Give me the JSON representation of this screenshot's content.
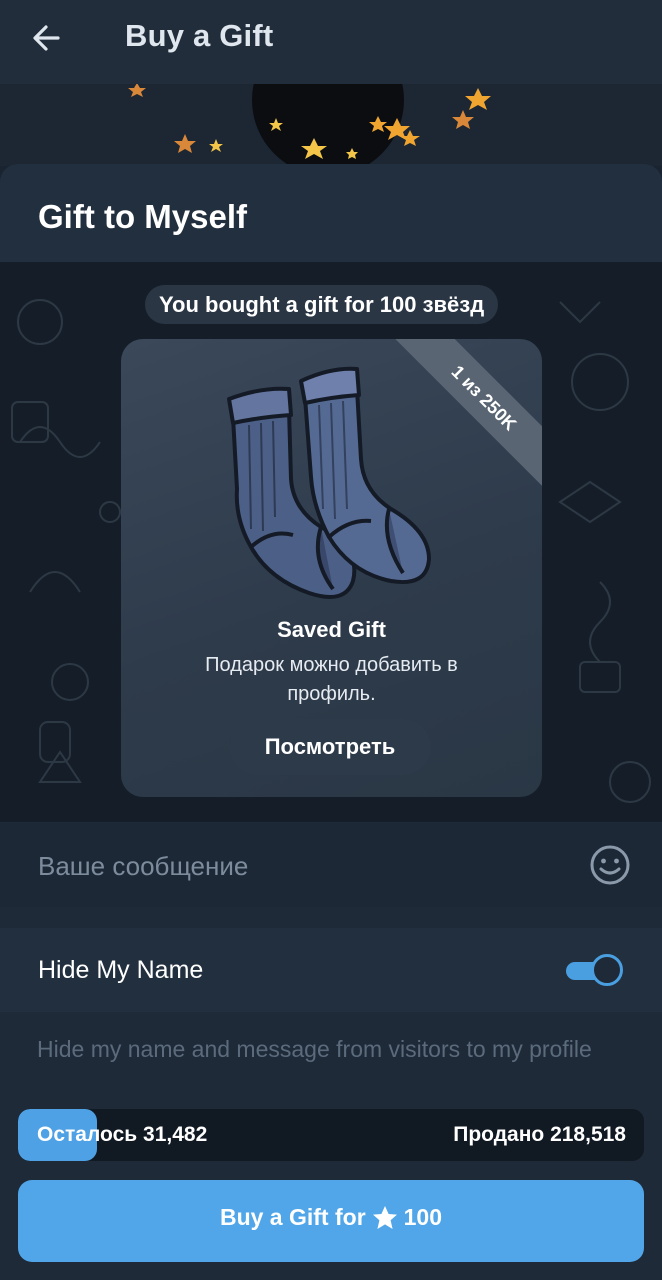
{
  "header": {
    "title": "Buy a Gift"
  },
  "sheet": {
    "title": "Gift to Myself"
  },
  "chat": {
    "service_message": "You bought a gift for 100 звёзд",
    "gift": {
      "ribbon": "1 из 250K",
      "title": "Saved Gift",
      "description": "Подарок можно добавить в профиль.",
      "view_button": "Посмотреть"
    }
  },
  "message": {
    "placeholder": "Ваше сообщение",
    "value": ""
  },
  "hide_name": {
    "label": "Hide My Name",
    "enabled": true,
    "hint": "Hide my name and message from visitors to my profile"
  },
  "availability": {
    "remaining_label": "Осталось 31,482",
    "sold_label": "Продано 218,518",
    "remaining_fraction": 0.126
  },
  "buy": {
    "label": "Buy a Gift for",
    "amount": "100",
    "currency_icon": "star-icon"
  },
  "colors": {
    "accent": "#50a6e8",
    "background": "#1e2a38"
  }
}
